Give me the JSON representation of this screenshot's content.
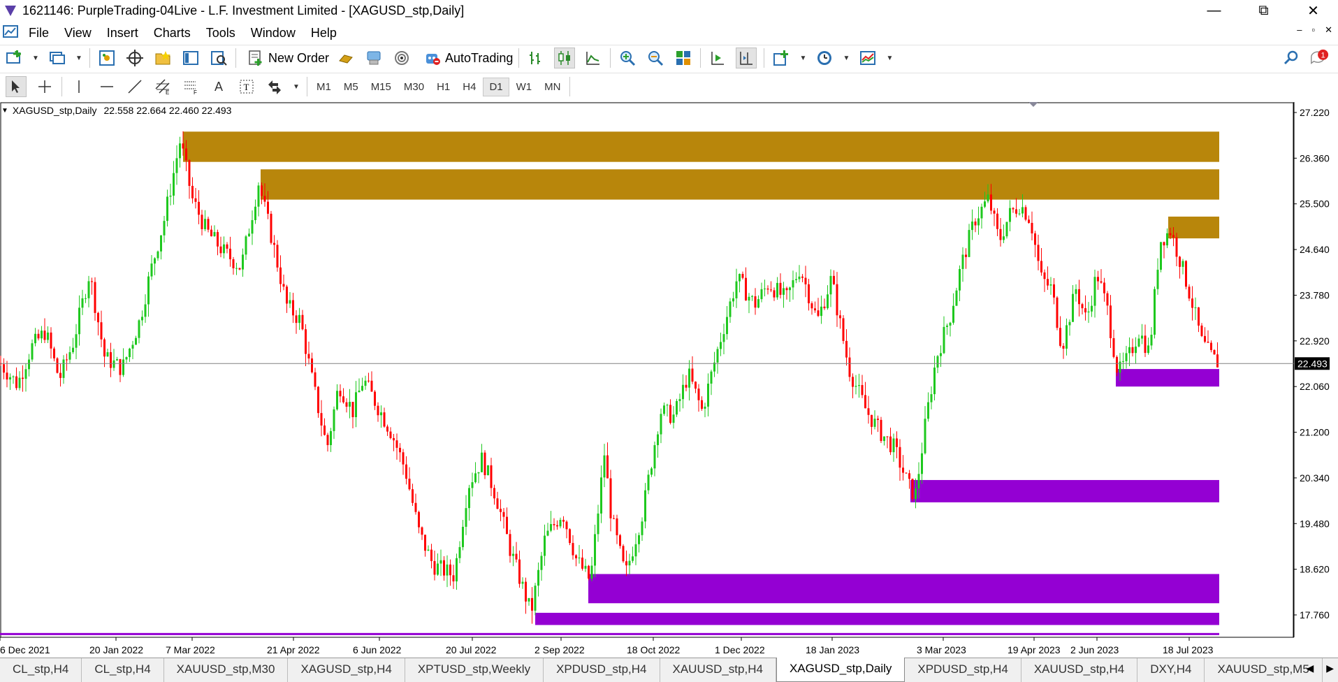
{
  "window": {
    "title": "1621146: PurpleTrading-04Live - L.F. Investment Limited - [XAGUSD_stp,Daily]",
    "controls": {
      "minimize": "—",
      "restore": "⧉",
      "close": "✕"
    }
  },
  "menu": {
    "items": [
      "File",
      "View",
      "Insert",
      "Charts",
      "Tools",
      "Window",
      "Help"
    ],
    "child_controls": {
      "minimize": "–",
      "restore": "▫",
      "close": "✕"
    }
  },
  "toolbar": {
    "new_order_label": "New Order",
    "autotrading_label": "AutoTrading",
    "notification_count": "1"
  },
  "timeframes": {
    "items": [
      "M1",
      "M5",
      "M15",
      "M30",
      "H1",
      "H4",
      "D1",
      "W1",
      "MN"
    ],
    "active": "D1"
  },
  "chart_header": {
    "symbol": "XAGUSD_stp,Daily",
    "ohlc": "22.558 22.664 22.460 22.493"
  },
  "chart_data": {
    "type": "candlestick",
    "symbol": "XAGUSD_stp",
    "timeframe": "Daily",
    "y_ticks": [
      "27.220",
      "26.360",
      "25.500",
      "24.640",
      "23.780",
      "22.920",
      "22.060",
      "21.200",
      "20.340",
      "19.480",
      "18.620",
      "17.760"
    ],
    "x_ticks": [
      "6 Dec 2021",
      "20 Jan 2022",
      "7 Mar 2022",
      "21 Apr 2022",
      "6 Jun 2022",
      "20 Jul 2022",
      "2 Sep 2022",
      "18 Oct 2022",
      "1 Dec 2022",
      "18 Jan 2023",
      "3 Mar 2023",
      "19 Apr 2023",
      "2 Jun 2023",
      "18 Jul 2023"
    ],
    "ylim": [
      17.4,
      27.4
    ],
    "current_price": 22.493,
    "current_price_label": "22.493",
    "colors": {
      "bull": "#1ec81e",
      "bear": "#ff0000",
      "supply": "#b8860b",
      "demand": "#9400d3",
      "price_line": "#808080",
      "price_label_bg": "#000000"
    },
    "close_path": [
      [
        0,
        22.5
      ],
      [
        25,
        22.1
      ],
      [
        45,
        22.8
      ],
      [
        65,
        23.1
      ],
      [
        85,
        22.2
      ],
      [
        105,
        22.9
      ],
      [
        128,
        24.2
      ],
      [
        150,
        22.6
      ],
      [
        175,
        22.4
      ],
      [
        200,
        23.3
      ],
      [
        215,
        24.2
      ],
      [
        235,
        25.2
      ],
      [
        258,
        26.7
      ],
      [
        275,
        25.6
      ],
      [
        295,
        25.0
      ],
      [
        320,
        24.6
      ],
      [
        345,
        24.3
      ],
      [
        370,
        25.9
      ],
      [
        390,
        24.8
      ],
      [
        410,
        23.6
      ],
      [
        430,
        23.3
      ],
      [
        448,
        22.1
      ],
      [
        468,
        20.9
      ],
      [
        485,
        22.1
      ],
      [
        505,
        21.6
      ],
      [
        520,
        22.2
      ],
      [
        540,
        21.7
      ],
      [
        560,
        21.2
      ],
      [
        580,
        20.5
      ],
      [
        600,
        19.3
      ],
      [
        620,
        18.7
      ],
      [
        650,
        18.5
      ],
      [
        670,
        20.2
      ],
      [
        690,
        20.7
      ],
      [
        710,
        20.0
      ],
      [
        730,
        19.0
      ],
      [
        760,
        17.8
      ],
      [
        780,
        19.2
      ],
      [
        805,
        19.7
      ],
      [
        825,
        18.8
      ],
      [
        845,
        18.4
      ],
      [
        865,
        20.8
      ],
      [
        875,
        19.6
      ],
      [
        895,
        18.5
      ],
      [
        920,
        19.7
      ],
      [
        945,
        21.6
      ],
      [
        965,
        21.5
      ],
      [
        985,
        22.3
      ],
      [
        1005,
        21.6
      ],
      [
        1030,
        22.9
      ],
      [
        1055,
        24.1
      ],
      [
        1080,
        23.6
      ],
      [
        1100,
        24.0
      ],
      [
        1125,
        23.7
      ],
      [
        1145,
        24.3
      ],
      [
        1170,
        23.3
      ],
      [
        1190,
        24.1
      ],
      [
        1200,
        23.4
      ],
      [
        1215,
        22.4
      ],
      [
        1240,
        21.6
      ],
      [
        1260,
        21.2
      ],
      [
        1280,
        20.9
      ],
      [
        1300,
        20.2
      ],
      [
        1310,
        20.0
      ],
      [
        1325,
        21.4
      ],
      [
        1340,
        22.6
      ],
      [
        1360,
        23.4
      ],
      [
        1375,
        24.3
      ],
      [
        1395,
        25.2
      ],
      [
        1415,
        25.6
      ],
      [
        1430,
        24.8
      ],
      [
        1445,
        25.3
      ],
      [
        1460,
        25.5
      ],
      [
        1475,
        25.2
      ],
      [
        1490,
        24.1
      ],
      [
        1505,
        23.9
      ],
      [
        1520,
        22.8
      ],
      [
        1540,
        23.9
      ],
      [
        1555,
        23.3
      ],
      [
        1570,
        24.2
      ],
      [
        1585,
        23.5
      ],
      [
        1600,
        22.3
      ],
      [
        1615,
        22.6
      ],
      [
        1630,
        23.1
      ],
      [
        1645,
        22.7
      ],
      [
        1660,
        24.8
      ],
      [
        1675,
        25.0
      ],
      [
        1690,
        24.4
      ],
      [
        1705,
        23.7
      ],
      [
        1720,
        22.9
      ],
      [
        1735,
        22.6
      ],
      [
        1745,
        22.49
      ]
    ],
    "zones": [
      {
        "kind": "supply",
        "start": "7 Mar 2022",
        "top": 26.86,
        "bottom": 26.29
      },
      {
        "kind": "supply",
        "start": "21 Apr 2022",
        "top": 26.15,
        "bottom": 25.58
      },
      {
        "kind": "supply",
        "start": "18 Jul 2023",
        "top": 25.26,
        "bottom": 24.85
      },
      {
        "kind": "demand",
        "start": "2 Jun 2023",
        "top": 22.39,
        "bottom": 22.06
      },
      {
        "kind": "demand",
        "start": "3 Mar 2023",
        "top": 20.3,
        "bottom": 19.88
      },
      {
        "kind": "demand",
        "start": "2 Sep 2022",
        "top": 18.53,
        "bottom": 17.98
      },
      {
        "kind": "demand",
        "start": "2 Sep 2022",
        "top": 17.8,
        "bottom": 17.57
      },
      {
        "kind": "demand",
        "start": "6 Dec 2021",
        "top": 17.42,
        "bottom": 17.38
      }
    ]
  },
  "tabs": {
    "items": [
      "CL_stp,H4",
      "CL_stp,H4",
      "XAUUSD_stp,M30",
      "XAGUSD_stp,H4",
      "XPTUSD_stp,Weekly",
      "XPDUSD_stp,H4",
      "XAUUSD_stp,H4",
      "XAGUSD_stp,Daily",
      "XPDUSD_stp,H4",
      "XAUUSD_stp,H4",
      "DXY,H4",
      "XAUUSD_stp,M5"
    ],
    "active_index": 7,
    "scroll_left": "◀",
    "scroll_right": "▶"
  }
}
